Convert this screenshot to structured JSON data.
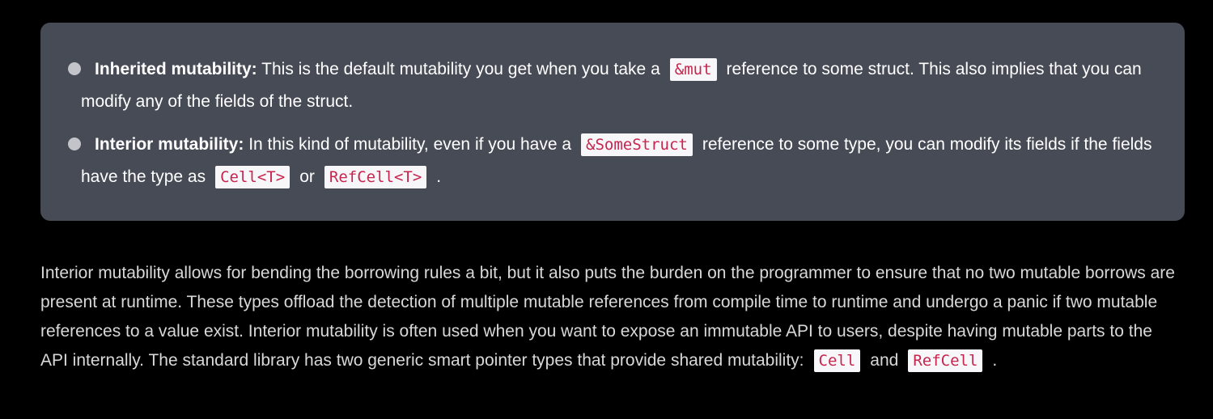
{
  "callout": {
    "items": [
      {
        "term": "Inherited mutability:",
        "text_before": " This is the default mutability you get when you take a",
        "code": "&mut",
        "text_after": "reference to some struct. This also implies that you can modify any of the fields of the struct."
      },
      {
        "term": "Interior mutability:",
        "text_before": " In this kind of mutability, even if you have a",
        "code": "&SomeStruct",
        "text_after": "reference to some type, you can modify its fields if the fields have the type as",
        "code2": "Cell<T>",
        "text_mid": "or",
        "code3": "RefCell<T>",
        "text_end": "."
      }
    ]
  },
  "paragraph": {
    "text": "Interior mutability allows for bending the borrowing rules a bit, but it also puts the burden on the programmer to ensure that no two mutable borrows are present at runtime. These types offload the detection of multiple mutable references from compile time to runtime and undergo a panic if two mutable references to a value exist. Interior mutability is often used when you want to expose an immutable API to users, despite having mutable parts to the API internally. The standard library has two generic smart pointer types that provide shared mutability:",
    "code1": "Cell",
    "conj": "and",
    "code2": "RefCell",
    "end": "."
  },
  "colors": {
    "page_bg": "#000000",
    "callout_bg": "#464b56",
    "code_fg": "#c7254e",
    "code_bg": "#f7f7f9"
  }
}
